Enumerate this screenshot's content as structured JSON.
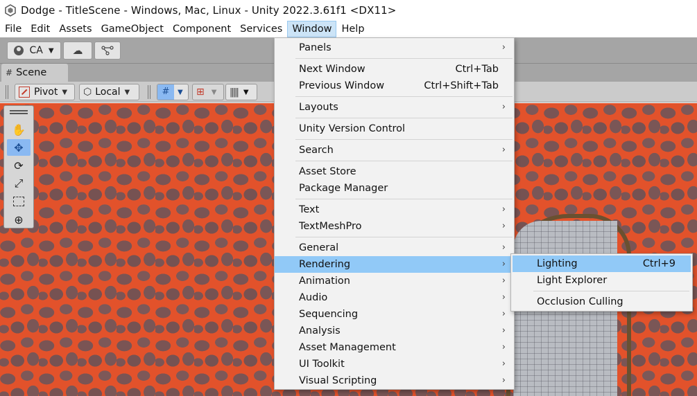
{
  "window": {
    "title": "Dodge - TitleScene - Windows, Mac, Linux - Unity 2022.3.61f1 <DX11>"
  },
  "menubar": {
    "items": [
      "File",
      "Edit",
      "Assets",
      "GameObject",
      "Component",
      "Services",
      "Window",
      "Help"
    ],
    "active": "Window"
  },
  "toolbar": {
    "account_label": "CA"
  },
  "scene": {
    "tab_label": "Scene",
    "pivot_label": "Pivot",
    "local_label": "Local"
  },
  "window_menu": {
    "items": [
      {
        "label": "Panels",
        "submenu": true
      },
      {
        "label": "Next Window",
        "shortcut": "Ctrl+Tab"
      },
      {
        "label": "Previous Window",
        "shortcut": "Ctrl+Shift+Tab"
      },
      {
        "label": "Layouts",
        "submenu": true
      },
      {
        "label": "Unity Version Control"
      },
      {
        "label": "Search",
        "submenu": true
      },
      {
        "label": "Asset Store"
      },
      {
        "label": "Package Manager"
      },
      {
        "label": "Text",
        "submenu": true
      },
      {
        "label": "TextMeshPro",
        "submenu": true
      },
      {
        "label": "General",
        "submenu": true
      },
      {
        "label": "Rendering",
        "submenu": true,
        "highlighted": true
      },
      {
        "label": "Animation",
        "submenu": true
      },
      {
        "label": "Audio",
        "submenu": true
      },
      {
        "label": "Sequencing",
        "submenu": true
      },
      {
        "label": "Analysis",
        "submenu": true
      },
      {
        "label": "Asset Management",
        "submenu": true
      },
      {
        "label": "UI Toolkit",
        "submenu": true
      },
      {
        "label": "Visual Scripting",
        "submenu": true
      }
    ]
  },
  "rendering_submenu": {
    "items": [
      {
        "label": "Lighting",
        "shortcut": "Ctrl+9",
        "highlighted": true
      },
      {
        "label": "Light Explorer"
      },
      {
        "label": "Occlusion Culling"
      }
    ]
  },
  "icons": {
    "submenu_arrow": "chevron-right-icon",
    "unity_logo": "unity-logo-icon"
  },
  "colors": {
    "highlight": "#91c9f7",
    "menu_active": "#cce4f7",
    "toolbar": "#a5a5a5"
  }
}
